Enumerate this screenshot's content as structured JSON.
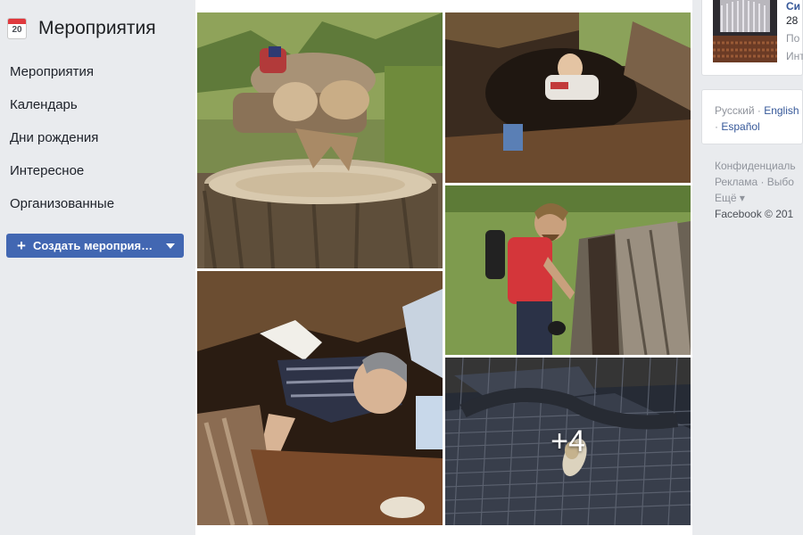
{
  "sidebar": {
    "icon_number": "20",
    "title": "Мероприятия",
    "items": [
      {
        "label": "Мероприятия"
      },
      {
        "label": "Календарь"
      },
      {
        "label": "Дни рождения"
      },
      {
        "label": "Интересное"
      },
      {
        "label": "Организованные"
      }
    ],
    "create_button": "Создать мероприя…"
  },
  "gallery": {
    "more_count": "+4"
  },
  "right": {
    "event": {
      "title": "Си",
      "date": "28",
      "line3": "По",
      "line4": "Инт"
    },
    "languages": {
      "current": "Русский",
      "separator": " · ",
      "english": "English",
      "spanish": "Español",
      "prefix_dot": "· "
    },
    "footer": {
      "line1": "Конфиденциаль",
      "line2": "Реклама · Выбо",
      "line3": "Ещё ▾",
      "line4": "Facebook © 201"
    }
  },
  "colors": {
    "accent": "#4267b2",
    "link": "#365899",
    "background": "#e9ebee"
  }
}
